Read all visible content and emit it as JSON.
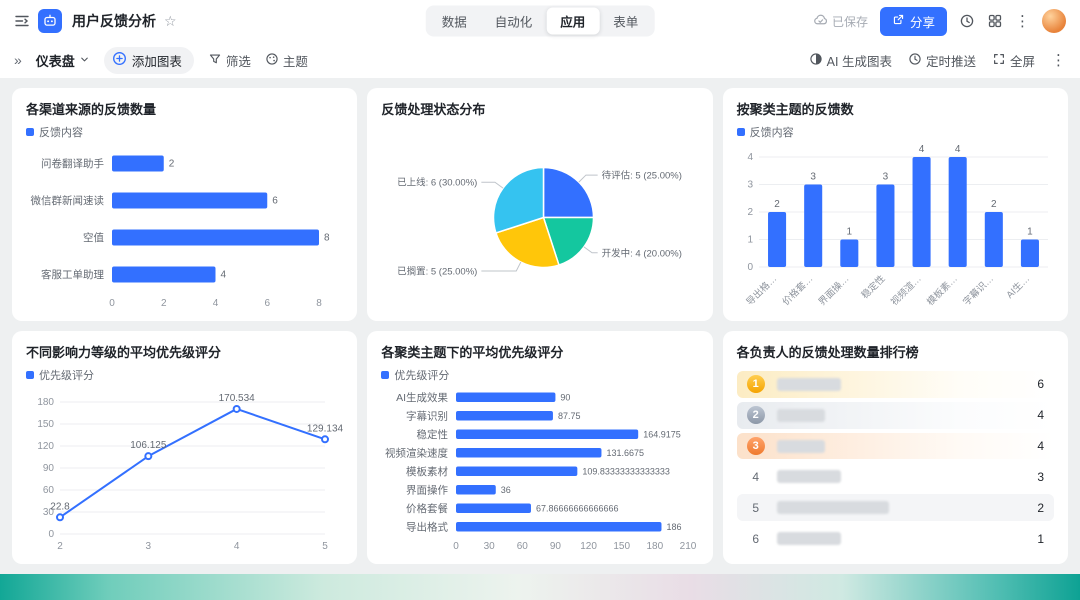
{
  "colors": {
    "accent": "#3370ff",
    "grid_line": "#eceef1",
    "axis_label": "#8f959e",
    "value_label": "#646a73",
    "canvas_bg": "#eef0f1"
  },
  "icons": {
    "star": "☆",
    "double_chevron": "»",
    "more_vertical": "⋮"
  },
  "topbar": {
    "title": "用户反馈分析",
    "tabs": [
      {
        "label": "数据"
      },
      {
        "label": "自动化"
      },
      {
        "label": "应用",
        "active": true
      },
      {
        "label": "表单"
      }
    ],
    "saved_label": "已保存",
    "share_label": "分享"
  },
  "toolbar": {
    "dashboard_label": "仪表盘",
    "add_chart_label": "添加图表",
    "filter_label": "筛选",
    "theme_label": "主题",
    "ai_label": "AI 生成图表",
    "push_label": "定时推送",
    "fullscreen_label": "全屏"
  },
  "chart_data": [
    {
      "type": "bar",
      "orientation": "horizontal",
      "title": "各渠道来源的反馈数量",
      "legend": [
        "反馈内容"
      ],
      "categories": [
        "问卷翻译助手",
        "微信群新闻速读",
        "空值",
        "客服工单助理"
      ],
      "values": [
        2,
        6,
        8,
        4
      ],
      "value_labels": [
        "2",
        "6",
        "8",
        "4"
      ],
      "xlim": [
        0,
        8
      ],
      "xticks": [
        0,
        2,
        4,
        6,
        8
      ],
      "right_pad": 24,
      "value_font": 10
    },
    {
      "type": "pie",
      "title": "反馈处理状态分布",
      "slices": [
        {
          "label": "待评估",
          "value": 5,
          "pct": "25.00%",
          "color": "#3370ff"
        },
        {
          "label": "开发中",
          "value": 4,
          "pct": "20.00%",
          "color": "#14c79f"
        },
        {
          "label": "已搁置",
          "value": 5,
          "pct": "25.00%",
          "color": "#ffc60a"
        },
        {
          "label": "已上线",
          "value": 6,
          "pct": "30.00%",
          "color": "#35c3f0"
        }
      ]
    },
    {
      "type": "bar",
      "orientation": "vertical",
      "title": "按聚类主题的反馈数",
      "legend": [
        "反馈内容"
      ],
      "categories": [
        "导出格式",
        "价格套餐",
        "界面操作",
        "稳定性",
        "视频渲染速度",
        "模板素材",
        "字幕识别",
        "AI生成效果"
      ],
      "values": [
        2,
        3,
        1,
        3,
        4,
        4,
        2,
        1
      ],
      "ylim": [
        0,
        4
      ],
      "yticks": [
        0,
        1,
        2,
        3,
        4
      ]
    },
    {
      "type": "line",
      "title": "不同影响力等级的平均优先级评分",
      "legend": [
        "优先级评分"
      ],
      "x": [
        2,
        3,
        4,
        5
      ],
      "values": [
        22.8,
        106.125,
        170.534,
        129.134
      ],
      "value_labels": [
        "22.8",
        "106.125",
        "170.534",
        "129.134"
      ],
      "ylim": [
        0,
        180
      ],
      "yticks": [
        0,
        30,
        60,
        90,
        120,
        150,
        180
      ]
    },
    {
      "type": "bar",
      "orientation": "horizontal",
      "title": "各聚类主题下的平均优先级评分",
      "legend": [
        "优先级评分"
      ],
      "categories": [
        "AI生成效果",
        "字幕识别",
        "稳定性",
        "视频渲染速度",
        "模板素材",
        "界面操作",
        "价格套餐",
        "导出格式"
      ],
      "values": [
        90,
        87.75,
        164.9175,
        131.6675,
        109.83333333333333,
        36,
        67.86666666666666,
        186
      ],
      "value_labels": [
        "90",
        "87.75",
        "164.9175",
        "131.6675",
        "109.83333333333333",
        "36",
        "67.86666666666666",
        "186"
      ],
      "xlim": [
        0,
        210
      ],
      "xticks": [
        0,
        30,
        60,
        90,
        120,
        150,
        180,
        210
      ],
      "right_pad": 10,
      "value_font": 9
    },
    {
      "type": "ranking",
      "title": "各负责人的反馈处理数量排行榜",
      "names_redacted": true,
      "rows": [
        {
          "rank": 1,
          "value": 6
        },
        {
          "rank": 2,
          "value": 4
        },
        {
          "rank": 3,
          "value": 4
        },
        {
          "rank": 4,
          "value": 3
        },
        {
          "rank": 5,
          "value": 2
        },
        {
          "rank": 6,
          "value": 1
        }
      ]
    }
  ]
}
